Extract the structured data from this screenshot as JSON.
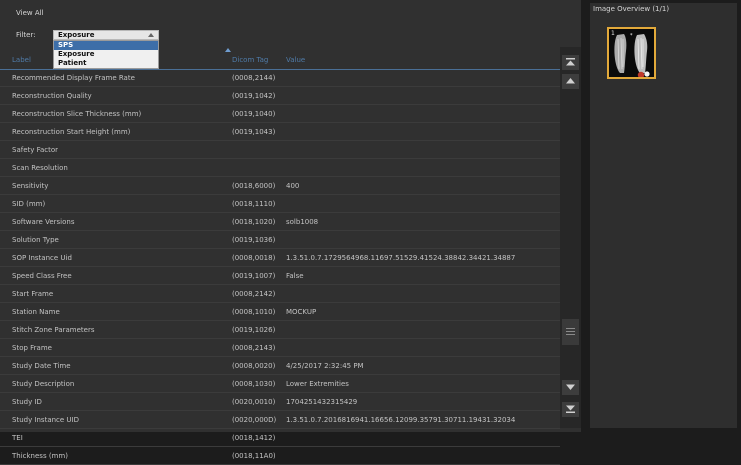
{
  "view_all_label": "View All",
  "filter": {
    "label": "Filter:",
    "selected": "Exposure",
    "options": [
      "SPS",
      "Exposure",
      "Patient"
    ],
    "highlighted": "SPS"
  },
  "table": {
    "columns": {
      "label": "Label",
      "tag": "Dicom Tag",
      "value": "Value"
    },
    "rows": [
      {
        "label": "Recommended Display Frame Rate",
        "tag": "(0008,2144)",
        "value": ""
      },
      {
        "label": "Reconstruction Quality",
        "tag": "(0019,1042)",
        "value": ""
      },
      {
        "label": "Reconstruction Slice Thickness (mm)",
        "tag": "(0019,1040)",
        "value": ""
      },
      {
        "label": "Reconstruction Start Height (mm)",
        "tag": "(0019,1043)",
        "value": ""
      },
      {
        "label": "Safety Factor",
        "tag": "",
        "value": ""
      },
      {
        "label": "Scan Resolution",
        "tag": "",
        "value": ""
      },
      {
        "label": "Sensitivity",
        "tag": "(0018,6000)",
        "value": "400"
      },
      {
        "label": "SID (mm)",
        "tag": "(0018,1110)",
        "value": ""
      },
      {
        "label": "Software Versions",
        "tag": "(0018,1020)",
        "value": "solb1008"
      },
      {
        "label": "Solution Type",
        "tag": "(0019,1036)",
        "value": ""
      },
      {
        "label": "SOP Instance Uid",
        "tag": "(0008,0018)",
        "value": "1.3.51.0.7.1729564968.11697.51529.41524.38842.34421.34887"
      },
      {
        "label": "Speed Class Free",
        "tag": "(0019,1007)",
        "value": "False"
      },
      {
        "label": "Start Frame",
        "tag": "(0008,2142)",
        "value": ""
      },
      {
        "label": "Station Name",
        "tag": "(0008,1010)",
        "value": "MOCKUP"
      },
      {
        "label": "Stitch Zone Parameters",
        "tag": "(0019,1026)",
        "value": ""
      },
      {
        "label": "Stop Frame",
        "tag": "(0008,2143)",
        "value": ""
      },
      {
        "label": "Study Date Time",
        "tag": "(0008,0020)",
        "value": "4/25/2017 2:32:45 PM"
      },
      {
        "label": "Study Description",
        "tag": "(0008,1030)",
        "value": "Lower Extremities"
      },
      {
        "label": "Study ID",
        "tag": "(0020,0010)",
        "value": "1704251432315429"
      },
      {
        "label": "Study Instance UID",
        "tag": "(0020,000D)",
        "value": "1.3.51.0.7.2016816941.16656.12099.35791.30711.19431.32034"
      },
      {
        "label": "TEI",
        "tag": "(0018,1412)",
        "value": ""
      },
      {
        "label": "Thickness (mm)",
        "tag": "(0018,11A0)",
        "value": ""
      }
    ]
  },
  "image_overview": {
    "title": "Image Overview (1/1)",
    "thumbnail_index": "1",
    "selected_border_color": "#e2a93a"
  },
  "icons": {
    "scroll_top": "scroll-to-top-icon",
    "scroll_up": "scroll-up-icon",
    "scroll_down": "scroll-down-icon",
    "scroll_bottom": "scroll-to-bottom-icon",
    "dropdown": "chevron-up-icon"
  },
  "colors": {
    "accent": "#4f7ba8",
    "selection": "#3d6ea8"
  }
}
